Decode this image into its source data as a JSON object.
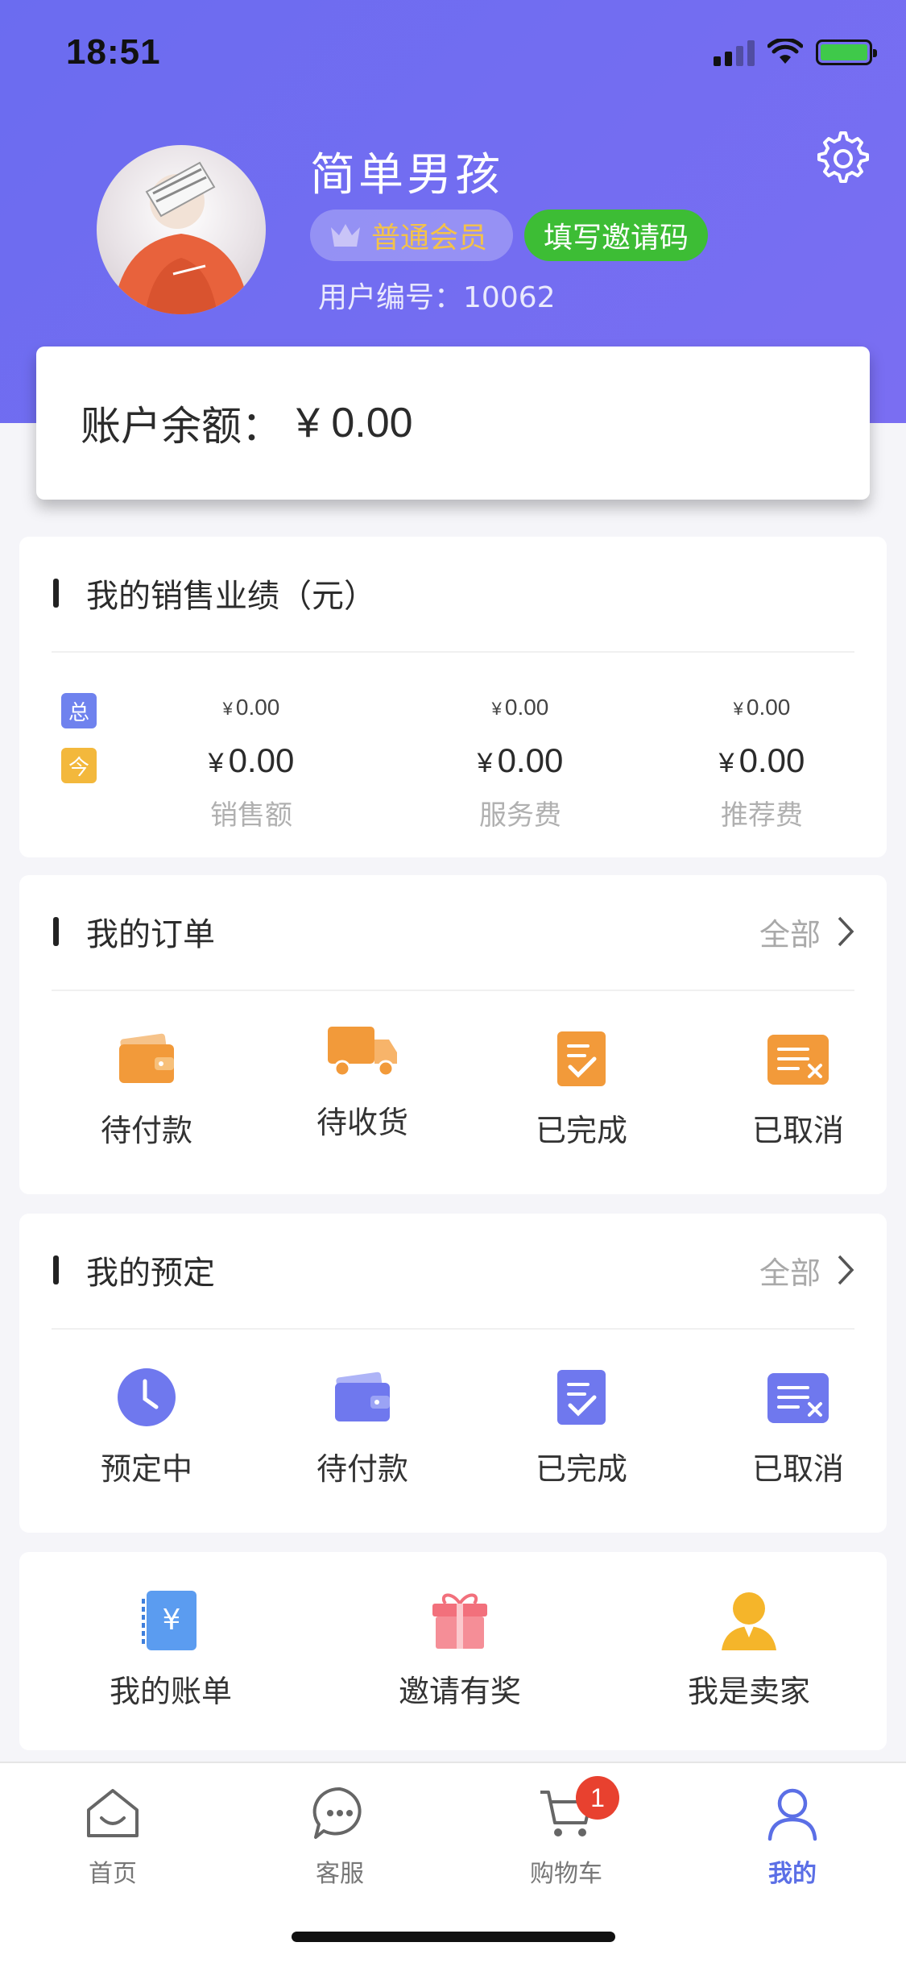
{
  "status_bar": {
    "time": "18:51"
  },
  "profile": {
    "name": "简单男孩",
    "member_badge": "普通会员",
    "invite_button": "填写邀请码",
    "user_id_label": "用户编号：",
    "user_id": "10062"
  },
  "balance": {
    "label": "账户余额：",
    "value": "¥ 0.00"
  },
  "sales": {
    "title": "我的销售业绩（元）",
    "tag_total": "总",
    "tag_today": "今",
    "columns": [
      {
        "total": "0.00",
        "today": "0.00",
        "label": "销售额"
      },
      {
        "total": "0.00",
        "today": "0.00",
        "label": "服务费"
      },
      {
        "total": "0.00",
        "today": "0.00",
        "label": "推荐费"
      }
    ],
    "currency": "¥"
  },
  "orders": {
    "title": "我的订单",
    "more": "全部",
    "items": [
      {
        "label": "待付款",
        "icon": "wallet-icon"
      },
      {
        "label": "待收货",
        "icon": "truck-icon"
      },
      {
        "label": "已完成",
        "icon": "checklist-icon"
      },
      {
        "label": "已取消",
        "icon": "cancel-list-icon"
      }
    ]
  },
  "reservations": {
    "title": "我的预定",
    "more": "全部",
    "items": [
      {
        "label": "预定中",
        "icon": "clock-icon"
      },
      {
        "label": "待付款",
        "icon": "wallet-icon"
      },
      {
        "label": "已完成",
        "icon": "checklist-icon"
      },
      {
        "label": "已取消",
        "icon": "cancel-list-icon"
      }
    ]
  },
  "tools": {
    "items": [
      {
        "label": "我的账单",
        "icon": "bill-icon"
      },
      {
        "label": "邀请有奖",
        "icon": "gift-icon"
      },
      {
        "label": "我是卖家",
        "icon": "seller-icon"
      }
    ]
  },
  "tabbar": {
    "items": [
      {
        "label": "首页",
        "icon": "home-icon"
      },
      {
        "label": "客服",
        "icon": "chat-icon"
      },
      {
        "label": "购物车",
        "icon": "cart-icon"
      },
      {
        "label": "我的",
        "icon": "user-icon"
      }
    ],
    "cart_count": "1"
  },
  "colors": {
    "header": "#6b6cf0",
    "accent_orange": "#f29a3a",
    "accent_purple": "#6f78ee",
    "invite_green": "#3dbd35",
    "active_tab": "#5b6fe6",
    "badge_red": "#e8412f"
  }
}
